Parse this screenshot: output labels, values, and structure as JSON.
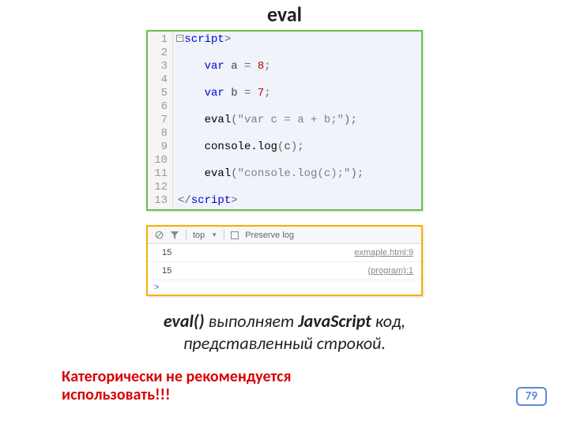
{
  "title": "eval",
  "code": {
    "lines": 13,
    "rows": [
      {
        "html": "<span class='fold'>−</span><span class='punct'>&lt;</span><span class='t'>script</span><span class='punct'>&gt;</span>"
      },
      {
        "html": ""
      },
      {
        "html": "    <span class='kw'>var</span> a <span class='punct'>=</span> <span class='n'>8</span><span class='punct'>;</span>"
      },
      {
        "html": ""
      },
      {
        "html": "    <span class='kw'>var</span> b <span class='punct'>=</span> <span class='n'>7</span><span class='punct'>;</span>"
      },
      {
        "html": ""
      },
      {
        "html": "    <span class='fn'>eval</span><span class='punct'>(</span><span class='s'>\"var c = a + b;\"</span><span class='punct'>);</span>"
      },
      {
        "html": ""
      },
      {
        "html": "    <span class='fn'>console.log</span><span class='punct'>(</span>c<span class='punct'>);</span>"
      },
      {
        "html": ""
      },
      {
        "html": "    <span class='fn'>eval</span><span class='punct'>(</span><span class='s'>\"console.log(c);\"</span><span class='punct'>);</span>"
      },
      {
        "html": ""
      },
      {
        "html": "<span class='punct'>&lt;/</span><span class='t'>script</span><span class='punct'>&gt;</span>"
      }
    ]
  },
  "console": {
    "toolbar": {
      "top": "top",
      "preserve": "Preserve log",
      "dropdown": "▼"
    },
    "rows": [
      {
        "value": "15",
        "source": "exmaple.html:9"
      },
      {
        "value": "15",
        "source": "(program):1"
      }
    ],
    "prompt": ">"
  },
  "description": {
    "l1_pre": "eval()",
    "l1_mid": " выполняет ",
    "l1_js": "JavaScript",
    "l1_post": " код,",
    "l2": "представленный строкой."
  },
  "warning": {
    "line1": "Категорически не рекомендуется",
    "line2": "использовать!!!"
  },
  "page": "79"
}
